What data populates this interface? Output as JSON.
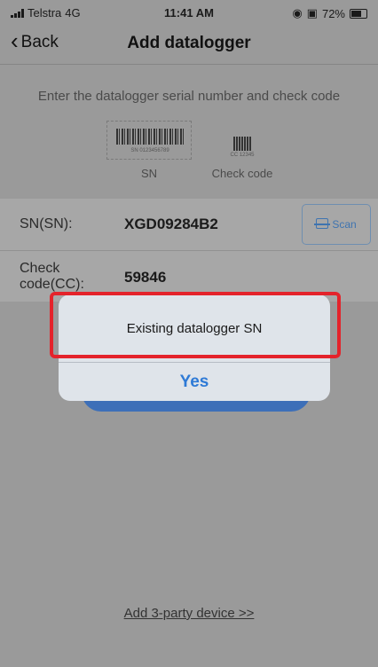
{
  "status_bar": {
    "carrier": "Telstra",
    "network": "4G",
    "time": "11:41 AM",
    "battery": "72%"
  },
  "nav": {
    "back_label": "Back",
    "title": "Add datalogger"
  },
  "instruction": "Enter the datalogger serial number and check code",
  "illustration": {
    "sn_barcode_text": "SN 0123456789",
    "sn_label": "SN",
    "cc_barcode_text": "CC 12345",
    "cc_label": "Check code"
  },
  "form": {
    "sn_label": "SN(SN):",
    "sn_value": "XGD09284B2",
    "scan_label": "Scan",
    "cc_label": "Check code(CC):",
    "cc_value": "59846"
  },
  "alert": {
    "message": "Existing datalogger SN",
    "button": "Yes"
  },
  "bottom_link": "Add 3-party device >>",
  "colors": {
    "accent": "#2e7ad6",
    "highlight": "#e4232b"
  }
}
